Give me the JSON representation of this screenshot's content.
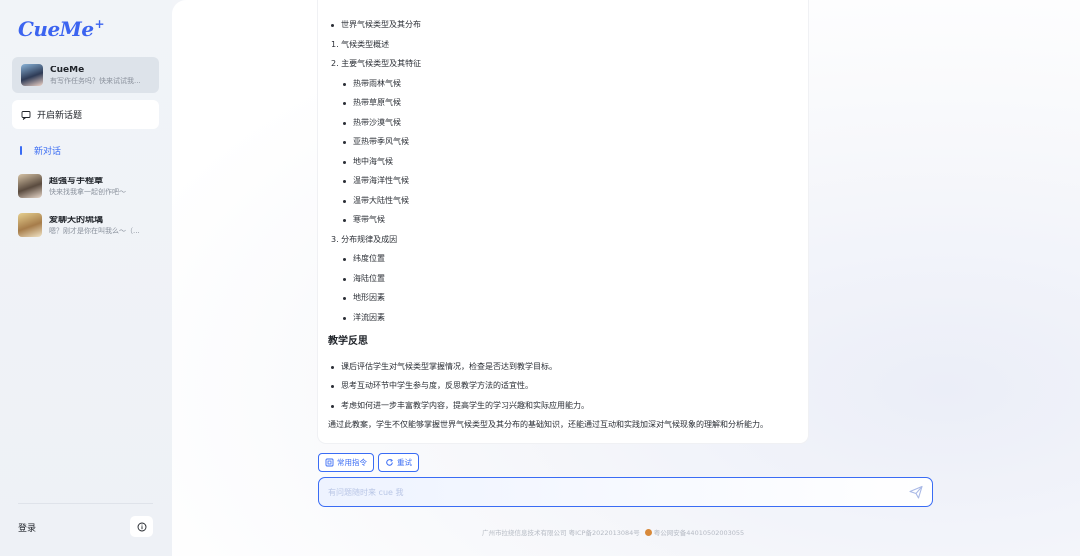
{
  "sidebar": {
    "logo": "CueMe",
    "logo_plus": "+",
    "current_bot": {
      "name": "CueMe",
      "subtitle": "有写作任务吗？快来试试我..."
    },
    "new_topic_label": "开启新话题",
    "new_chat_label": "新对话",
    "bots": [
      {
        "name": "超强写手程章",
        "subtitle": "快来找我拿一起创作吧～"
      },
      {
        "name": "爱聊天的琉璃",
        "subtitle": "嗯？刚才是你在叫我么～（..."
      }
    ],
    "login_label": "登录"
  },
  "message": {
    "lines": [
      {
        "text": "世界气候类型及其分布",
        "style": "dot"
      },
      {
        "text": "1. 气候类型概述",
        "style": "plain"
      },
      {
        "text": "2. 主要气候类型及其特征",
        "style": "plain"
      },
      {
        "text": "热带雨林气候",
        "style": "dot"
      },
      {
        "text": "热带草原气候",
        "style": "dot"
      },
      {
        "text": "热带沙漠气候",
        "style": "dot"
      },
      {
        "text": "亚热带季风气候",
        "style": "dot"
      },
      {
        "text": "地中海气候",
        "style": "dot"
      },
      {
        "text": "温带海洋性气候",
        "style": "dot"
      },
      {
        "text": "温带大陆性气候",
        "style": "dot"
      },
      {
        "text": "寒带气候",
        "style": "dot"
      },
      {
        "text": "3. 分布规律及成因",
        "style": "plain"
      },
      {
        "text": "纬度位置",
        "style": "dot"
      },
      {
        "text": "海陆位置",
        "style": "dot"
      },
      {
        "text": "地形因素",
        "style": "dot"
      },
      {
        "text": "洋流因素",
        "style": "dot"
      }
    ],
    "reflection_heading": "教学反思",
    "reflection_items": [
      "课后评估学生对气候类型掌握情况，检查是否达到教学目标。",
      "思考互动环节中学生参与度，反思教学方法的适宜性。",
      "考虑如何进一步丰富教学内容，提高学生的学习兴趣和实际应用能力。"
    ],
    "summary": "通过此教案，学生不仅能够掌握世界气候类型及其分布的基础知识，还能通过互动和实践加深对气候现象的理解和分析能力。"
  },
  "actions": {
    "common_commands": "常用指令",
    "retry": "重试"
  },
  "composer": {
    "placeholder": "有问题随时来 cue 我"
  },
  "footer": {
    "company_icp": "广州市拉绕信息技术有限公司 粤ICP备2022013084号",
    "police": "粤公网安备44010502003055"
  }
}
